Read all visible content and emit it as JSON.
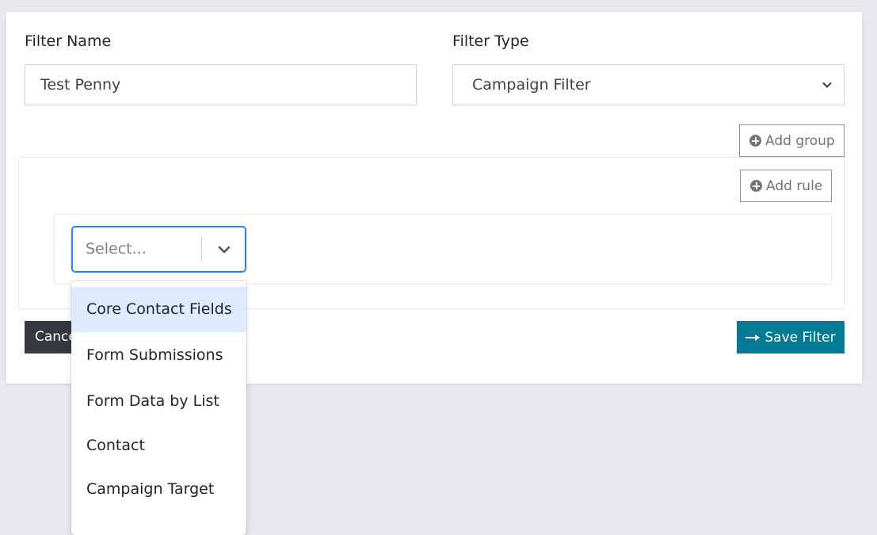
{
  "form": {
    "filter_name_label": "Filter Name",
    "filter_name_value": "Test Penny",
    "filter_type_label": "Filter Type",
    "filter_type_value": "Campaign Filter"
  },
  "builder": {
    "add_group_label": "Add group",
    "add_rule_label": "Add rule",
    "field_select_placeholder": "Select..."
  },
  "dropdown": {
    "options": [
      "Core Contact Fields",
      "Form Submissions",
      "Form Data by List",
      "Contact",
      "Campaign Target"
    ],
    "highlighted_index": 0
  },
  "actions": {
    "cancel_label": "Cancel",
    "save_label": "Save Filter"
  },
  "colors": {
    "save_button": "#007a95",
    "cancel_button": "#343a40",
    "select_focus_border": "#2684ff",
    "option_highlight": "#deebff"
  },
  "icons": {
    "add_group": "plus-circle-icon",
    "add_rule": "plus-circle-icon",
    "save": "arrow-right-icon",
    "filter_type_select": "chevron-down-icon",
    "field_select": "chevron-down-icon"
  }
}
